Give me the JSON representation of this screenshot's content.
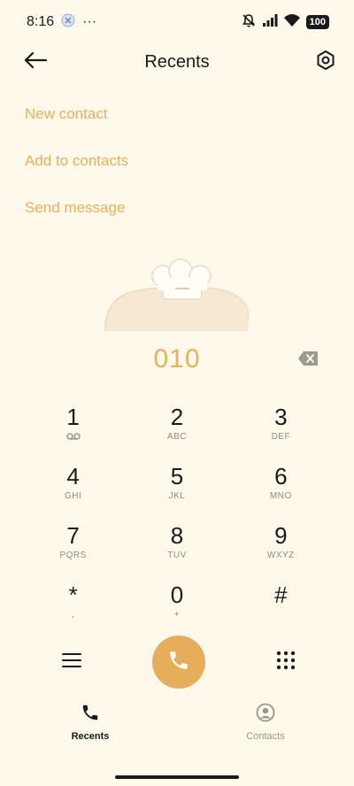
{
  "status_bar": {
    "time": "8:16",
    "overflow": "···",
    "battery": "100",
    "icons": [
      "notification-bubble-icon",
      "silent-bell-icon",
      "signal-icon",
      "wifi-icon",
      "battery-icon"
    ]
  },
  "header": {
    "title": "Recents"
  },
  "actions": [
    {
      "label": "New contact"
    },
    {
      "label": "Add to contacts"
    },
    {
      "label": "Send message"
    }
  ],
  "dialer": {
    "number": "010",
    "keys": [
      {
        "digit": "1",
        "letters": ""
      },
      {
        "digit": "2",
        "letters": "ABC"
      },
      {
        "digit": "3",
        "letters": "DEF"
      },
      {
        "digit": "4",
        "letters": "GHI"
      },
      {
        "digit": "5",
        "letters": "JKL"
      },
      {
        "digit": "6",
        "letters": "MNO"
      },
      {
        "digit": "7",
        "letters": "PQRS"
      },
      {
        "digit": "8",
        "letters": "TUV"
      },
      {
        "digit": "9",
        "letters": "WXYZ"
      },
      {
        "digit": "*",
        "letters": ","
      },
      {
        "digit": "0",
        "letters": "+"
      },
      {
        "digit": "#",
        "letters": ""
      }
    ]
  },
  "tabs": [
    {
      "label": "Recents",
      "active": true
    },
    {
      "label": "Contacts",
      "active": false
    }
  ],
  "colors": {
    "background": "#FFF9EC",
    "accent": "#E6B15C",
    "call_button": "#E6AE5A"
  }
}
